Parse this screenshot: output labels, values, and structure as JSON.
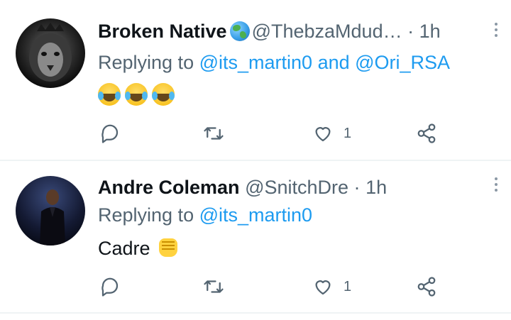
{
  "colors": {
    "accent": "#1d9bf0",
    "secondary_text": "#536471",
    "primary_text": "#0f1419",
    "divider": "#eff3f4"
  },
  "tweets": [
    {
      "name": "Broken Native",
      "handle": "@ThebzaMdud…",
      "separator": "·",
      "time": "1h",
      "replying_prefix": "Replying to ",
      "mention_1": "@its_martin0",
      "conjunction": " and ",
      "mention_2": "@Ori_RSA",
      "body_emojis": [
        "face-with-tears-of-joy",
        "face-with-tears-of-joy",
        "face-with-tears-of-joy"
      ],
      "like_count": "1",
      "avatar": "lion-avatar"
    },
    {
      "name": "Andre Coleman",
      "handle": "@SnitchDre",
      "separator": "·",
      "time": "1h",
      "replying_prefix": "Replying to ",
      "mention_1": "@its_martin0",
      "body_text": "Cadre",
      "body_emojis": [
        "raised-fist"
      ],
      "like_count": "1",
      "avatar": "person-avatar"
    }
  ]
}
